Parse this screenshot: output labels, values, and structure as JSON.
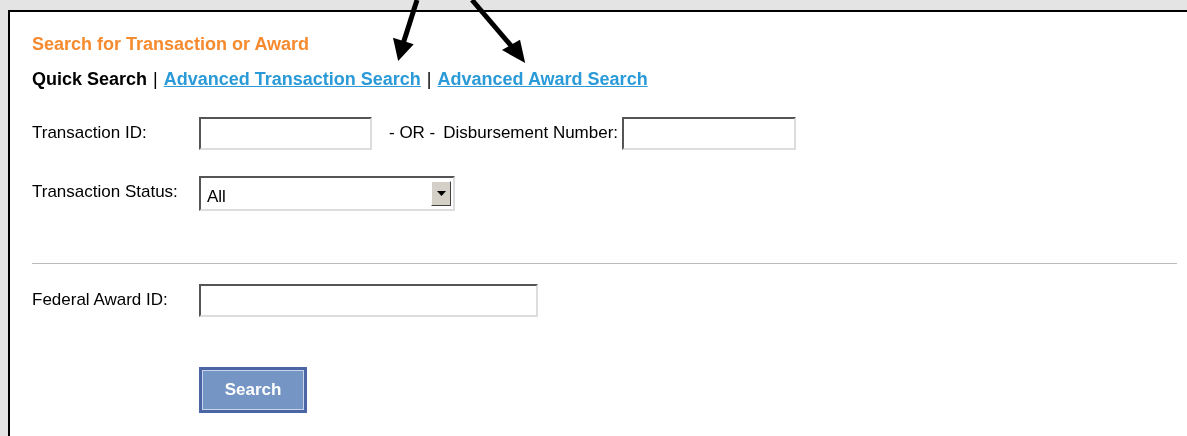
{
  "title": "Search for Transaction or Award",
  "nav_separators": [
    "|",
    "|"
  ],
  "nav": [
    {
      "label": "Quick Search",
      "selected": true
    },
    {
      "label": "Advanced Transaction Search",
      "selected": false
    },
    {
      "label": "Advanced Award Search",
      "selected": false
    }
  ],
  "transaction_id": {
    "label": "Transaction ID:"
  },
  "or_text": "- OR -",
  "disbursement_number": {
    "label": "Disbursement Number:"
  },
  "transaction_status": {
    "label": "Transaction Status:",
    "value": "All"
  },
  "federal_award_id": {
    "label": "Federal Award ID:"
  },
  "search_button": "Search"
}
